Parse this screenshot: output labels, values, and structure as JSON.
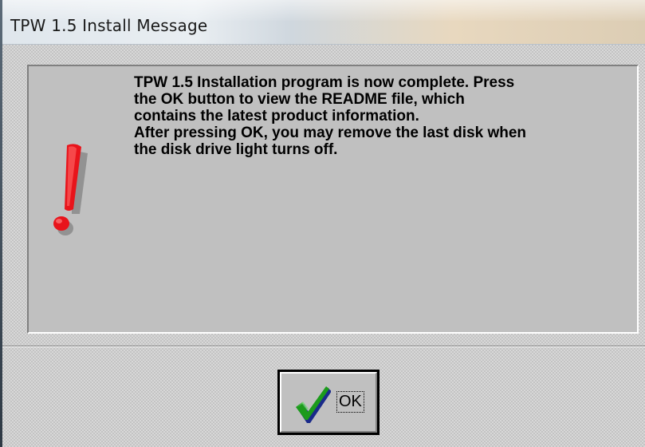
{
  "window": {
    "title": "TPW 1.5 Install Message"
  },
  "message": {
    "lines": [
      "TPW 1.5 Installation program is now complete.  Press",
      "the OK button to view the README file, which",
      "contains the latest product information.",
      "After pressing OK, you may remove the last disk when",
      "the disk drive light turns off."
    ],
    "icon": "exclamation-icon"
  },
  "buttons": {
    "ok_label": "OK",
    "ok_icon": "checkmark-icon"
  },
  "colors": {
    "exclamation": "#e8141b",
    "checkmark_green": "#1c9b1c",
    "checkmark_blue": "#1a2a8a"
  }
}
